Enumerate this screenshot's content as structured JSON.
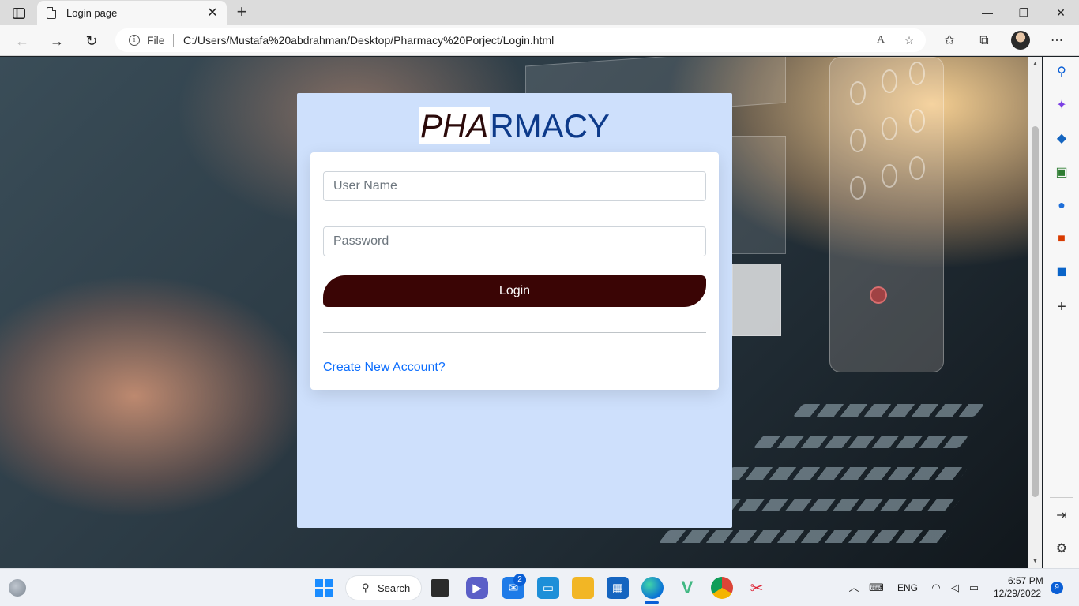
{
  "browser": {
    "tab_title": "Login page",
    "file_label": "File",
    "url": "C:/Users/Mustafa%20abdrahman/Desktop/Pharmacy%20Porject/Login.html",
    "tab_close_glyph": "✕",
    "new_tab_glyph": "+",
    "window_controls": {
      "minimize": "—",
      "restore": "❐",
      "close": "✕"
    },
    "nav": {
      "back": "←",
      "forward": "→",
      "refresh": "↻"
    },
    "toolbar_icons": [
      "read-aloud-icon",
      "add-favorite-icon",
      "favorites-icon",
      "collections-icon",
      "profile-avatar",
      "more-icon"
    ]
  },
  "login": {
    "brand_part1": "PHA",
    "brand_part2": "RMACY",
    "username_placeholder": "User Name",
    "password_placeholder": "Password",
    "login_button": "Login",
    "create_account_link": "Create New Account?"
  },
  "colors": {
    "card_background": "#cee0fc",
    "brand_blue": "#0d3a8a",
    "brand_dark": "#2b0a0a",
    "button_background": "#3a0505",
    "link": "#0d6efd"
  },
  "edge_sidebar": {
    "icons": [
      "search-icon",
      "copilot-icon",
      "shopping-tag-icon",
      "tools-icon",
      "games-icon",
      "office-icon",
      "outlook-icon",
      "add-icon",
      "split-screen-icon",
      "settings-icon"
    ]
  },
  "taskbar": {
    "search_label": "Search",
    "mail_badge": "2",
    "language": "ENG",
    "time": "6:57 PM",
    "date": "12/29/2022",
    "notification_count": "9",
    "apps": [
      "start-icon",
      "search",
      "task-view-icon",
      "meet-icon",
      "mail-icon",
      "monitor-icon",
      "file-explorer-icon",
      "store-icon",
      "edge-icon",
      "vue-icon",
      "chrome-icon",
      "snipping-tool-icon"
    ]
  }
}
